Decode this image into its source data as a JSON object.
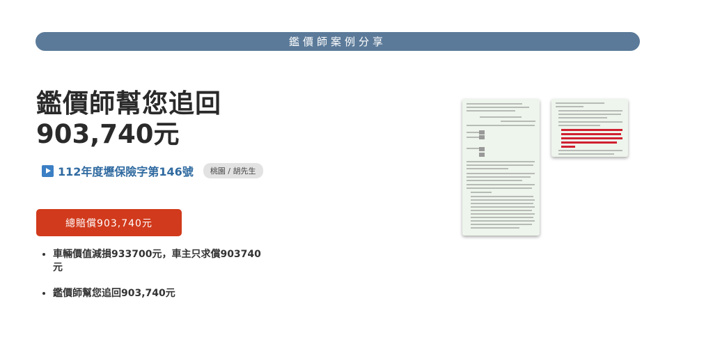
{
  "banner": {
    "text": "鑑價師案例分享"
  },
  "hero": {
    "title": "鑑價師幫您追回",
    "amount": "903,740元"
  },
  "case": {
    "number": "112年度壢保險字第146號",
    "client": "桃園 / 胡先生",
    "icon": "play-icon"
  },
  "cta": {
    "label": "總賠償903,740元"
  },
  "points": [
    "車輛價值減損933700元，車主只求償903740元",
    "鑑價師幫您追回903,740元"
  ],
  "documents": [
    {
      "name": "judgment-document-page-1"
    },
    {
      "name": "judgment-document-page-2"
    }
  ],
  "colors": {
    "banner": "#5b7a99",
    "cta": "#d13a1c",
    "case_blue": "#2f6aa0"
  }
}
